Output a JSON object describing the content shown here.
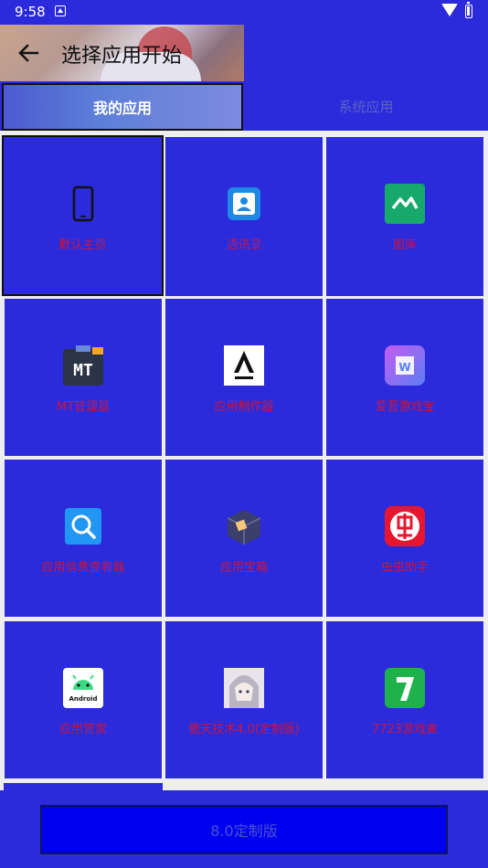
{
  "status": {
    "time": "9:58"
  },
  "toolbar": {
    "title": "选择应用开始"
  },
  "tabs": [
    {
      "label": "我的应用"
    },
    {
      "label": "系统应用"
    }
  ],
  "apps": [
    {
      "label": "默认主页",
      "icon": "phone-icon"
    },
    {
      "label": "通讯录",
      "icon": "contacts-icon"
    },
    {
      "label": "图库",
      "icon": "gallery-icon"
    },
    {
      "label": "MT管理器",
      "icon": "mt-manager-icon"
    },
    {
      "label": "应用制作器",
      "icon": "app-maker-icon"
    },
    {
      "label": "爱吾游戏宝",
      "icon": "aiwu-game-icon"
    },
    {
      "label": "应用信息查看器",
      "icon": "app-info-viewer-icon"
    },
    {
      "label": "应用宝箱",
      "icon": "app-box-icon"
    },
    {
      "label": "虫虫助手",
      "icon": "chongchong-icon"
    },
    {
      "label": "应用管家",
      "icon": "android-manager-icon"
    },
    {
      "label": "傲天技术4.0(定制版)",
      "icon": "aotian-avatar-icon"
    },
    {
      "label": "7723游戏盒",
      "icon": "7723-game-box-icon"
    }
  ],
  "bottom": {
    "button_label": "8.0定制版"
  },
  "colors": {
    "background": "#2b2bdb",
    "label": "#d0143a",
    "grid_gap": "#eeeeee"
  }
}
